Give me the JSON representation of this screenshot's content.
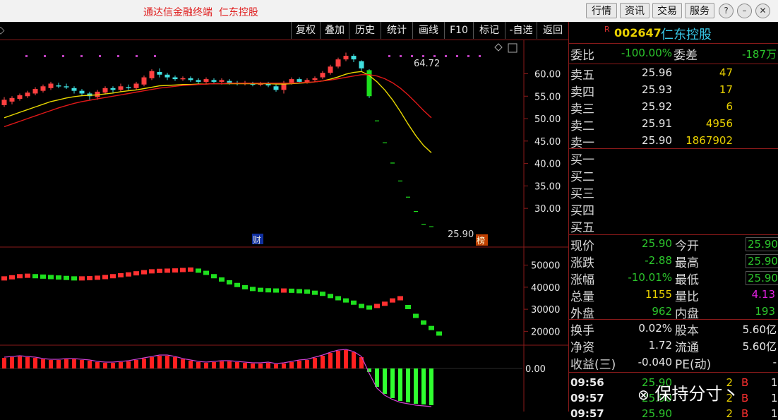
{
  "window": {
    "title": "通达信金融终端  仁东控股",
    "buttons": [
      "行情",
      "资讯",
      "交易",
      "服务"
    ]
  },
  "toolbar": {
    "left_arrow": "◇",
    "items": [
      "复权",
      "叠加",
      "历史",
      "统计",
      "画线",
      "F10",
      "标记",
      "-自选",
      "返回"
    ]
  },
  "stock": {
    "badge": "R",
    "code": "002647",
    "name": "仁东控股"
  },
  "order_book": {
    "weibi_label": "委比",
    "weibi": "-100.00%",
    "weicha_label": "委差",
    "weicha": "-187万",
    "sells": [
      {
        "label": "卖五",
        "price": "25.96",
        "vol": "47"
      },
      {
        "label": "卖四",
        "price": "25.93",
        "vol": "17"
      },
      {
        "label": "卖三",
        "price": "25.92",
        "vol": "6"
      },
      {
        "label": "卖二",
        "price": "25.91",
        "vol": "4956"
      },
      {
        "label": "卖一",
        "price": "25.90",
        "vol": "1867902"
      }
    ],
    "buys": [
      "买一",
      "买二",
      "买三",
      "买四",
      "买五"
    ]
  },
  "quote": {
    "rows": [
      {
        "l1": "现价",
        "v1": "25.90",
        "l2": "今开",
        "v2": "25.90"
      },
      {
        "l1": "涨跌",
        "v1": "-2.88",
        "l2": "最高",
        "v2": "25.90"
      },
      {
        "l1": "涨幅",
        "v1": "-10.01%",
        "l2": "最低",
        "v2": "25.90"
      },
      {
        "l1": "总量",
        "v1": "1155",
        "l2": "量比",
        "v2": "4.13"
      },
      {
        "l1": "外盘",
        "v1": "962",
        "l2": "内盘",
        "v2": "193"
      }
    ],
    "rows2": [
      {
        "l1": "换手",
        "v1": "0.02%",
        "l2": "股本",
        "v2": "5.60亿"
      },
      {
        "l1": "净资",
        "v1": "1.72",
        "l2": "流通",
        "v2": "5.60亿"
      },
      {
        "l1": "收益(三)",
        "v1": "-0.040",
        "l2": "PE(动)",
        "v2": "-"
      }
    ]
  },
  "ticks": [
    {
      "time": "09:56",
      "price": "25.90",
      "vol": "2",
      "flag": "B",
      "n": "1"
    },
    {
      "time": "09:57",
      "price": "25.90",
      "vol": "2",
      "flag": "B",
      "n": "1"
    },
    {
      "time": "09:57",
      "price": "25.90",
      "vol": "2",
      "flag": "B",
      "n": "1"
    }
  ],
  "watermark": "保持分寸丶",
  "chart_data": {
    "type": "candlestick",
    "price_axis": {
      "ticks": [
        "60.00",
        "55.00",
        "50.00",
        "45.00",
        "40.00",
        "35.00",
        "30.00"
      ],
      "range": [
        22.0,
        67.0
      ]
    },
    "high_label": "64.72",
    "last_label": "25.90",
    "marker_cai": "财",
    "marker_bang": "榜",
    "candles": [
      [
        53.0,
        54.2,
        52.6,
        54.8
      ],
      [
        53.8,
        54.6,
        53.2,
        55.0
      ],
      [
        54.4,
        55.2,
        54.0,
        55.6
      ],
      [
        55.0,
        55.8,
        54.6,
        56.2
      ],
      [
        55.6,
        56.6,
        55.2,
        57.0
      ],
      [
        56.2,
        57.2,
        55.8,
        57.6
      ],
      [
        56.8,
        57.8,
        56.4,
        58.2
      ],
      [
        57.4,
        57.2,
        56.8,
        58.0
      ],
      [
        57.2,
        57.0,
        56.6,
        57.8
      ],
      [
        56.8,
        56.2,
        55.6,
        57.2
      ],
      [
        56.2,
        55.6,
        55.0,
        56.6
      ],
      [
        55.6,
        55.0,
        54.2,
        56.0
      ],
      [
        54.8,
        56.0,
        54.2,
        56.4
      ],
      [
        55.8,
        56.8,
        55.4,
        57.2
      ],
      [
        56.8,
        56.4,
        55.8,
        57.2
      ],
      [
        56.4,
        57.2,
        56.0,
        57.8
      ],
      [
        57.0,
        56.8,
        56.4,
        57.6
      ],
      [
        56.8,
        57.8,
        56.4,
        58.2
      ],
      [
        57.6,
        59.2,
        57.2,
        59.6
      ],
      [
        59.0,
        60.6,
        58.6,
        61.0
      ],
      [
        60.4,
        59.8,
        59.2,
        61.2
      ],
      [
        59.8,
        59.2,
        58.6,
        60.2
      ],
      [
        59.2,
        58.8,
        58.4,
        59.6
      ],
      [
        58.8,
        59.0,
        58.4,
        59.4
      ],
      [
        59.0,
        58.6,
        58.2,
        59.4
      ],
      [
        58.6,
        58.2,
        57.8,
        59.0
      ],
      [
        58.2,
        58.8,
        57.8,
        59.2
      ],
      [
        58.6,
        58.2,
        57.8,
        59.0
      ],
      [
        58.2,
        58.6,
        57.6,
        59.0
      ],
      [
        58.4,
        58.0,
        57.6,
        58.8
      ],
      [
        58.0,
        57.8,
        57.4,
        58.4
      ],
      [
        57.8,
        58.0,
        57.4,
        58.4
      ],
      [
        57.8,
        57.6,
        57.2,
        58.2
      ],
      [
        57.6,
        57.8,
        57.2,
        58.2
      ],
      [
        57.8,
        57.4,
        57.0,
        58.2
      ],
      [
        57.2,
        56.4,
        56.0,
        57.6
      ],
      [
        56.4,
        58.0,
        55.6,
        58.4
      ],
      [
        58.0,
        58.8,
        57.6,
        59.2
      ],
      [
        58.8,
        58.2,
        57.8,
        59.2
      ],
      [
        58.2,
        58.6,
        57.8,
        59.0
      ],
      [
        58.6,
        59.0,
        58.2,
        59.4
      ],
      [
        59.2,
        60.2,
        58.8,
        60.6
      ],
      [
        60.2,
        61.6,
        59.8,
        62.0
      ],
      [
        61.6,
        63.2,
        61.2,
        63.6
      ],
      [
        63.2,
        64.0,
        62.8,
        64.72
      ],
      [
        64.0,
        63.2,
        62.6,
        64.4
      ],
      [
        62.8,
        61.2,
        60.6,
        63.0
      ],
      [
        60.8,
        55.0,
        54.6,
        61.0
      ],
      [
        49.5,
        49.5,
        49.5,
        49.5
      ],
      [
        44.6,
        44.6,
        44.6,
        44.6
      ],
      [
        40.1,
        40.1,
        40.1,
        40.1
      ],
      [
        36.1,
        36.1,
        36.1,
        36.1
      ],
      [
        32.5,
        32.5,
        32.5,
        32.5
      ],
      [
        29.3,
        29.3,
        29.3,
        29.3
      ],
      [
        26.4,
        26.4,
        26.4,
        26.4
      ],
      [
        25.9,
        25.9,
        25.9,
        25.9
      ]
    ],
    "ma_yellow": [
      50.2,
      50.8,
      51.4,
      52.0,
      52.6,
      53.2,
      53.8,
      54.2,
      54.6,
      54.9,
      55.1,
      55.2,
      55.3,
      55.5,
      55.7,
      56.0,
      56.2,
      56.4,
      56.7,
      57.0,
      57.3,
      57.4,
      57.5,
      57.6,
      57.6,
      57.7,
      57.7,
      57.8,
      57.8,
      57.8,
      57.8,
      57.8,
      57.8,
      57.8,
      57.8,
      57.7,
      57.7,
      57.8,
      57.9,
      58.0,
      58.2,
      58.4,
      58.8,
      59.3,
      59.9,
      60.3,
      60.5,
      59.6,
      58.2,
      56.4,
      54.2,
      51.6,
      48.8,
      46.2,
      44.0,
      42.4
    ],
    "ma_red": [
      48.2,
      48.8,
      49.4,
      50.0,
      50.6,
      51.2,
      51.8,
      52.4,
      52.9,
      53.4,
      53.8,
      54.1,
      54.4,
      54.7,
      55.0,
      55.3,
      55.6,
      55.9,
      56.2,
      56.5,
      56.8,
      57.0,
      57.2,
      57.4,
      57.5,
      57.6,
      57.7,
      57.8,
      57.8,
      57.9,
      57.9,
      57.9,
      57.9,
      57.9,
      57.9,
      57.9,
      57.9,
      57.9,
      58.0,
      58.1,
      58.2,
      58.4,
      58.6,
      58.9,
      59.2,
      59.5,
      59.8,
      59.8,
      59.5,
      58.9,
      58.0,
      56.8,
      55.3,
      53.6,
      51.8,
      50.2
    ],
    "volume_axis": {
      "ticks": [
        "50000",
        "40000",
        "30000",
        "20000"
      ],
      "range": [
        15000,
        55000
      ]
    },
    "volume_line": [
      44000,
      44500,
      45000,
      45200,
      45000,
      44800,
      44600,
      44400,
      44200,
      44000,
      44000,
      44100,
      44300,
      44600,
      45000,
      45400,
      45800,
      46300,
      46800,
      47200,
      47400,
      47500,
      47600,
      47800,
      48000,
      47500,
      46500,
      45000,
      43500,
      42200,
      41000,
      40000,
      39200,
      38800,
      38600,
      38500,
      38500,
      38400,
      38200,
      38000,
      37500,
      37000,
      36000,
      35000,
      34000,
      33000,
      31500,
      30800,
      31500,
      32500,
      34000,
      35000,
      31000,
      27000,
      24000,
      21500,
      19000
    ],
    "macd_zero": "0.00",
    "macd_hist": [
      1.5,
      1.6,
      1.7,
      1.6,
      1.5,
      1.3,
      1.2,
      1.2,
      1.3,
      1.3,
      1.2,
      1.1,
      0.9,
      0.8,
      0.8,
      0.9,
      1.0,
      1.2,
      1.4,
      1.6,
      1.8,
      1.8,
      1.6,
      1.3,
      1.1,
      0.9,
      0.8,
      0.9,
      1.0,
      1.0,
      0.9,
      0.8,
      0.7,
      0.7,
      0.8,
      0.6,
      0.7,
      0.9,
      1.1,
      1.2,
      1.5,
      1.8,
      2.2,
      2.5,
      2.6,
      2.3,
      1.6,
      -0.5,
      -2.6,
      -3.6,
      -4.2,
      -4.6,
      -4.8,
      -5.0,
      -5.1,
      -5.2
    ]
  }
}
